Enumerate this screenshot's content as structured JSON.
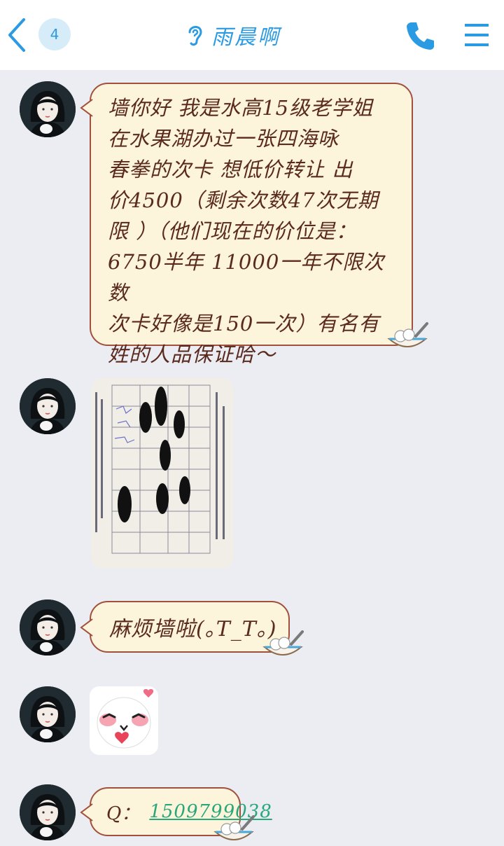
{
  "header": {
    "unread_count": "4",
    "title": "雨晨啊",
    "icons": [
      "back-arrow-icon",
      "ear-icon",
      "phone-icon",
      "menu-icon"
    ],
    "accent_color": "#2a9be2"
  },
  "messages": [
    {
      "type": "text",
      "lines": [
        "墙你好 我是水高15级老学姐",
        "在水果湖办过一张四海咏",
        "春拳的次卡 想低价转让 出",
        "价4500（剩余次数47次无期",
        "限 ）（他们现在的价位是：",
        "6750半年 11000一年不限次数",
        "次卡好像是150一次）有名有",
        "姓的人品保证哈～"
      ]
    },
    {
      "type": "image",
      "description_icon": "contract-photo"
    },
    {
      "type": "text",
      "text": "麻烦墙啦(｡T_T｡)"
    },
    {
      "type": "sticker",
      "icon": "blush-face-sticker"
    },
    {
      "type": "text",
      "label": "Q：",
      "number": "1509799038"
    }
  ],
  "colors": {
    "bubble_bg": "#fdf4dc",
    "bubble_border": "#a0503c",
    "text": "#5a2a1e",
    "link": "#2aa77a",
    "chat_bg": "#ebedf2"
  }
}
